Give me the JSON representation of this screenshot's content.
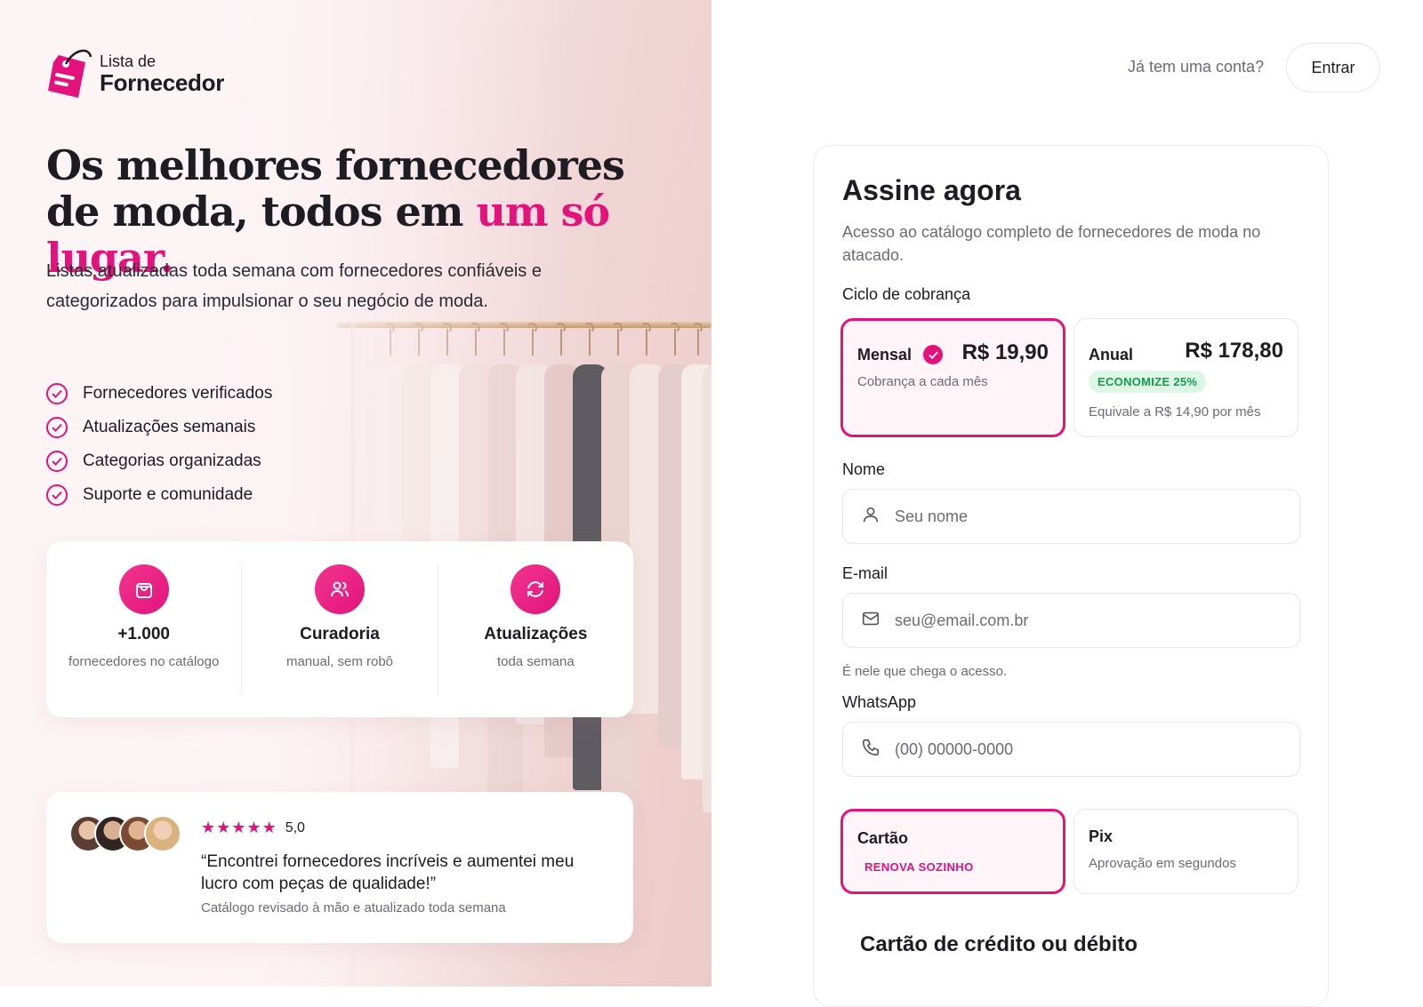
{
  "brand": {
    "name_small": "Lista de",
    "name_big": "Fornecedor"
  },
  "hero": {
    "title_part1": "Os melhores fornecedores de moda, todos em ",
    "title_accent": "um só lugar.",
    "subtitle": "Listas atualizadas toda semana com fornecedores confiáveis e categorizados para impulsionar o seu negócio de moda."
  },
  "features": [
    "Fornecedores verificados",
    "Atualizações semanais",
    "Categorias organizadas",
    "Suporte e comunidade"
  ],
  "stats": [
    {
      "icon": "shopping-bag-icon",
      "title": "+1.000",
      "desc": "fornecedores no catálogo"
    },
    {
      "icon": "users-icon",
      "title": "Curadoria",
      "desc": "manual, sem robô"
    },
    {
      "icon": "refresh-icon",
      "title": "Atualizações",
      "desc": "toda semana"
    }
  ],
  "review": {
    "rating": "5,0",
    "stars": 5,
    "quote": "“Encontrei fornecedores incríveis e aumentei meu lucro com peças de qualidade!”",
    "note": "Catálogo revisado à mão e atualizado toda semana"
  },
  "topbar": {
    "question": "Já tem uma conta?",
    "login_label": "Entrar"
  },
  "form": {
    "title": "Assine agora",
    "subtitle": "Acesso ao catálogo completo de fornecedores de moda no atacado.",
    "billing_label": "Ciclo de cobrança",
    "plans": [
      {
        "name": "Mensal",
        "price": "R$ 19,90",
        "desc": "Cobrança a cada mês",
        "selected": true
      },
      {
        "name": "Anual",
        "price": "R$ 178,80",
        "badge": "ECONOMIZE 25%",
        "desc": "Equivale a R$ 14,90 por mês",
        "selected": false
      }
    ],
    "name_label": "Nome",
    "name_placeholder": "Seu nome",
    "email_label": "E-mail",
    "email_placeholder": "seu@email.com.br",
    "email_hint": "É nele que chega o acesso.",
    "whatsapp_label": "WhatsApp",
    "whatsapp_placeholder": "(00) 00000-0000",
    "payments": [
      {
        "name": "Cartão",
        "badge": "RENOVA SOZINHO",
        "selected": true
      },
      {
        "name": "Pix",
        "desc": "Aprovação em segundos",
        "selected": false
      }
    ],
    "card_section_title": "Cartão de crédito ou débito"
  },
  "colors": {
    "accent": "#e3127c",
    "success": "#169a4c",
    "success_bg": "#dcf7e6"
  }
}
